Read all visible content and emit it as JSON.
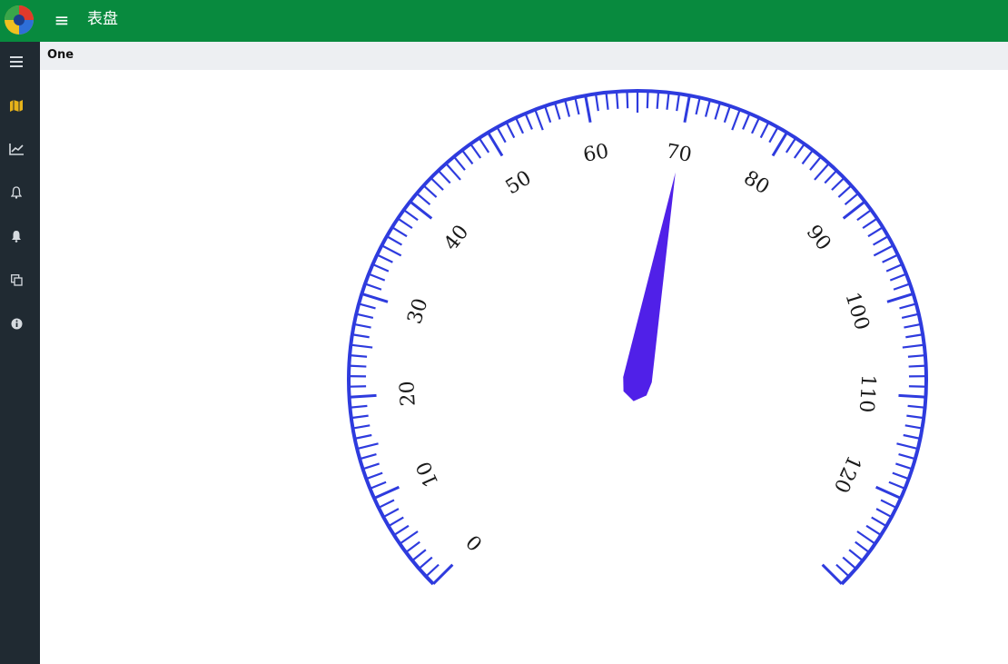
{
  "app": {
    "title": "表盘"
  },
  "header": {
    "page_label": "One"
  },
  "sidebar": {
    "items": [
      {
        "icon": "menu-icon"
      },
      {
        "icon": "map-icon"
      },
      {
        "icon": "line-chart-icon"
      },
      {
        "icon": "bell-outline-icon"
      },
      {
        "icon": "bell-filled-icon"
      },
      {
        "icon": "copy-icon"
      },
      {
        "icon": "info-icon"
      }
    ]
  },
  "gauge": {
    "min": 0,
    "max": 130,
    "value": 70,
    "tick_labels": [
      "0",
      "10",
      "20",
      "30",
      "40",
      "50",
      "60",
      "70",
      "80",
      "90",
      "100",
      "110",
      "120"
    ],
    "tick_color": "#2e3bde",
    "needle_color": "#5020e8"
  },
  "colors": {
    "topbar": "#088a3e",
    "sidebar": "#202a32",
    "header": "#edeff2",
    "map_icon": "#e7b31a"
  }
}
